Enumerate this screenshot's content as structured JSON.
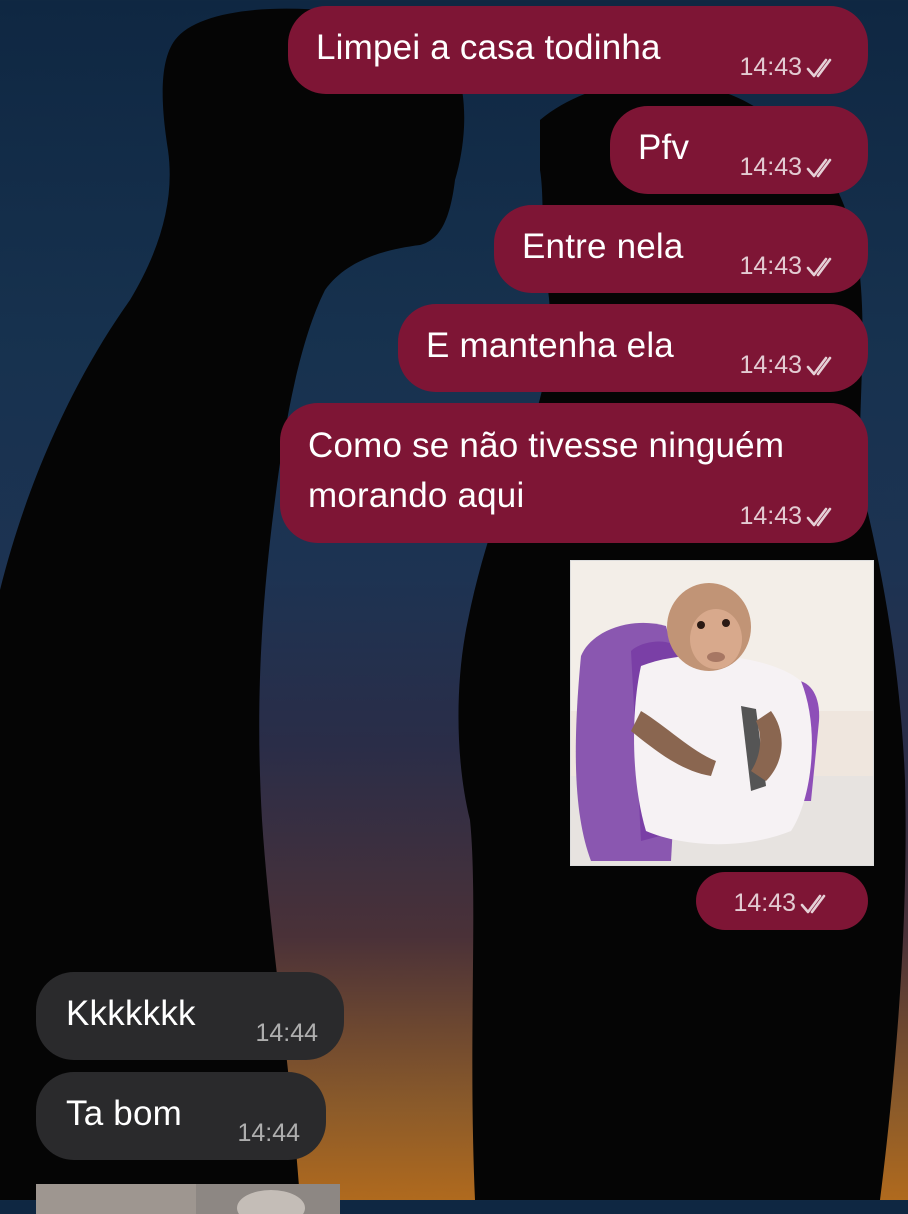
{
  "messages": [
    {
      "dir": "out",
      "text": "Limpei a casa todinha",
      "time": "14:43",
      "status": "read"
    },
    {
      "dir": "out",
      "text": "Pfv",
      "time": "14:43",
      "status": "read"
    },
    {
      "dir": "out",
      "text": "Entre nela",
      "time": "14:43",
      "status": "read"
    },
    {
      "dir": "out",
      "text": "E mantenha ela",
      "time": "14:43",
      "status": "read"
    },
    {
      "dir": "out",
      "text_lines": [
        "Como se não tivesse ninguém",
        "morando aqui"
      ],
      "time": "14:43",
      "status": "read"
    },
    {
      "dir": "out",
      "type": "image",
      "image_subject": "monkey wearing a purple backpack"
    },
    {
      "dir": "out",
      "type": "image_time",
      "time": "14:43",
      "status": "read"
    },
    {
      "dir": "in",
      "text": "Kkkkkkk",
      "time": "14:44"
    },
    {
      "dir": "in",
      "text": "Ta bom",
      "time": "14:44"
    },
    {
      "dir": "in",
      "type": "image",
      "partial": true
    }
  ],
  "colors": {
    "outgoing_bubble": "#7e1535",
    "incoming_bubble": "#2a2a2c",
    "text": "#ffffff",
    "wallpaper_top": "#0f2742",
    "wallpaper_bottom": "#b06a1e"
  },
  "icons": {
    "read_receipt": "double-check-icon"
  }
}
